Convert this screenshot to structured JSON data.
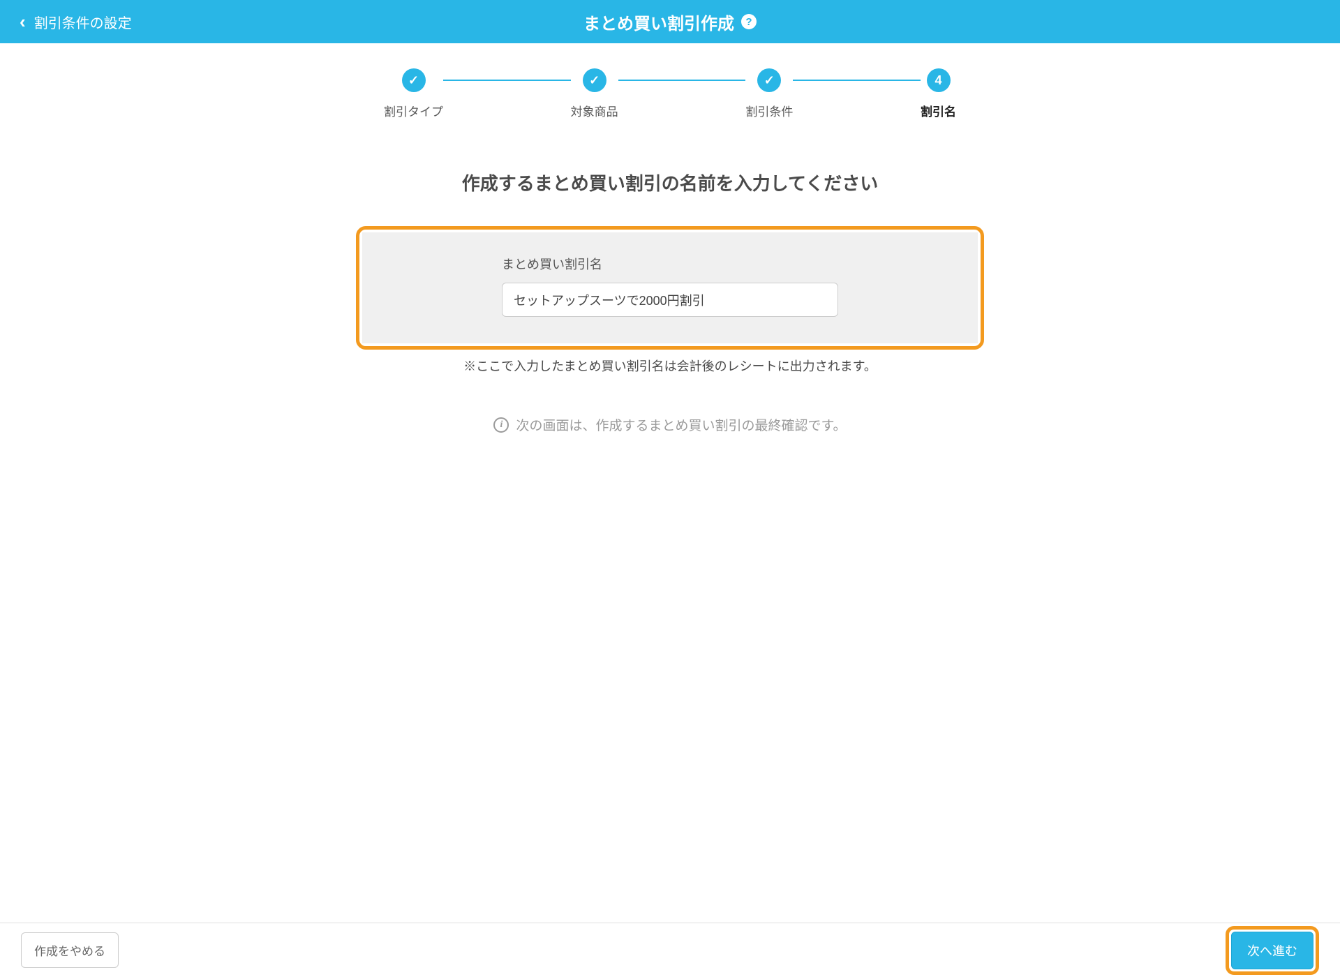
{
  "header": {
    "back_label": "割引条件の設定",
    "title": "まとめ買い割引作成",
    "help_symbol": "?"
  },
  "steps": [
    {
      "label": "割引タイプ",
      "completed": true
    },
    {
      "label": "対象商品",
      "completed": true
    },
    {
      "label": "割引条件",
      "completed": true
    },
    {
      "label": "割引名",
      "completed": false,
      "number": "4",
      "active": true
    }
  ],
  "main": {
    "title": "作成するまとめ買い割引の名前を入力してください",
    "field_label": "まとめ買い割引名",
    "field_value": "セットアップスーツで2000円割引",
    "note": "※ここで入力したまとめ買い割引名は会計後のレシートに出力されます。",
    "info": "次の画面は、作成するまとめ買い割引の最終確認です。"
  },
  "footer": {
    "cancel_label": "作成をやめる",
    "next_label": "次へ進む"
  }
}
